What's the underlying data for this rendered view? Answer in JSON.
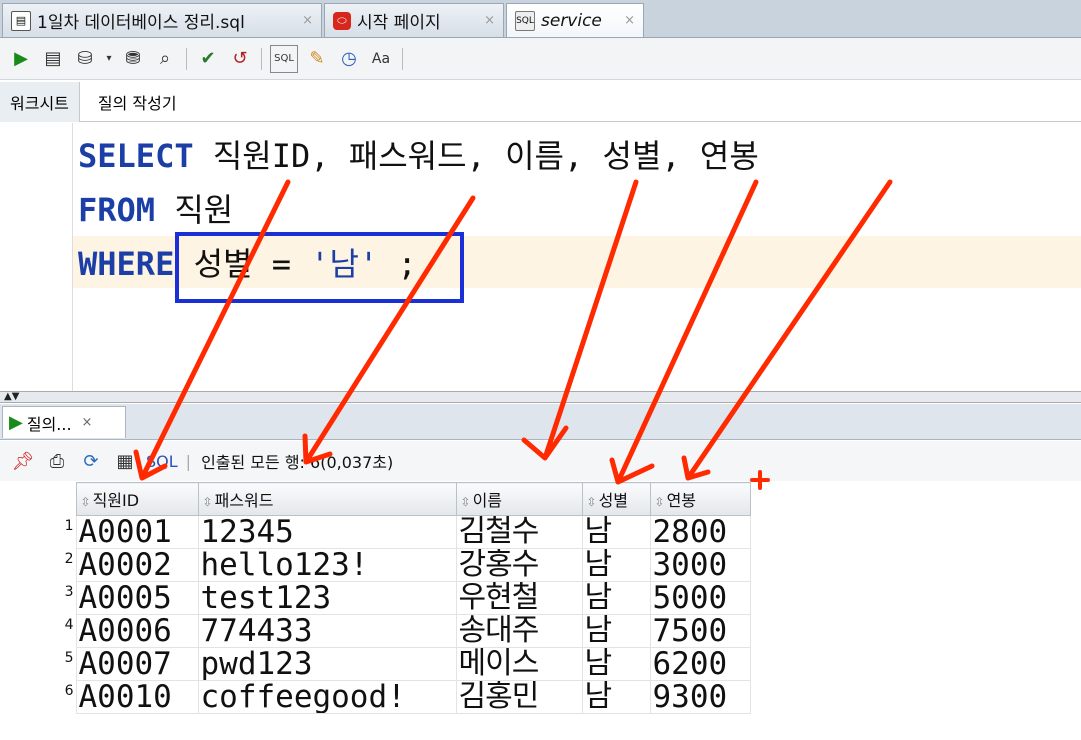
{
  "tabs": [
    {
      "label": "1일차 데이터베이스 정리.sql",
      "icon": "sql-file-icon",
      "close": "×"
    },
    {
      "label": "시작 페이지",
      "icon": "oracle-start-icon",
      "close": "×"
    },
    {
      "label": "service",
      "icon": "sql-connection-icon",
      "close": "×"
    }
  ],
  "subtabs": [
    "워크시트",
    "질의 작성기"
  ],
  "sql": {
    "line1_kw": "SELECT",
    "line1_rest": " 직원ID, 패스워드, 이름, 성별, 연봉",
    "line2_kw": "FROM",
    "line2_rest": " 직원",
    "line3_kw": "WHERE",
    "line3_col": " 성별 = ",
    "line3_str": "'남'",
    "line3_end": " ;"
  },
  "results": {
    "tab_label": "질의...",
    "tab_close": "×",
    "sql_label": "SQL",
    "status": "인출된 모든 행: 6(0,037초)",
    "columns": [
      "직원ID",
      "패스워드",
      "이름",
      "성별",
      "연봉"
    ],
    "rows": [
      {
        "n": "1",
        "id": "A0001",
        "pw": "12345",
        "name": "김철수",
        "sex": "남",
        "sal": "2800"
      },
      {
        "n": "2",
        "id": "A0002",
        "pw": "hello123!",
        "name": "강홍수",
        "sex": "남",
        "sal": "3000"
      },
      {
        "n": "3",
        "id": "A0005",
        "pw": "test123",
        "name": "우현철",
        "sex": "남",
        "sal": "5000"
      },
      {
        "n": "4",
        "id": "A0006",
        "pw": "774433",
        "name": "송대주",
        "sex": "남",
        "sal": "7500"
      },
      {
        "n": "5",
        "id": "A0007",
        "pw": "pwd123",
        "name": "메이스",
        "sex": "남",
        "sal": "6200"
      },
      {
        "n": "6",
        "id": "A0010",
        "pw": "coffeegood!",
        "name": "김홍민",
        "sex": "남",
        "sal": "9300"
      }
    ]
  },
  "colors": {
    "keyword": "#1b3fa6",
    "annotation": "#ff2a00",
    "box": "#1a2fd6"
  }
}
